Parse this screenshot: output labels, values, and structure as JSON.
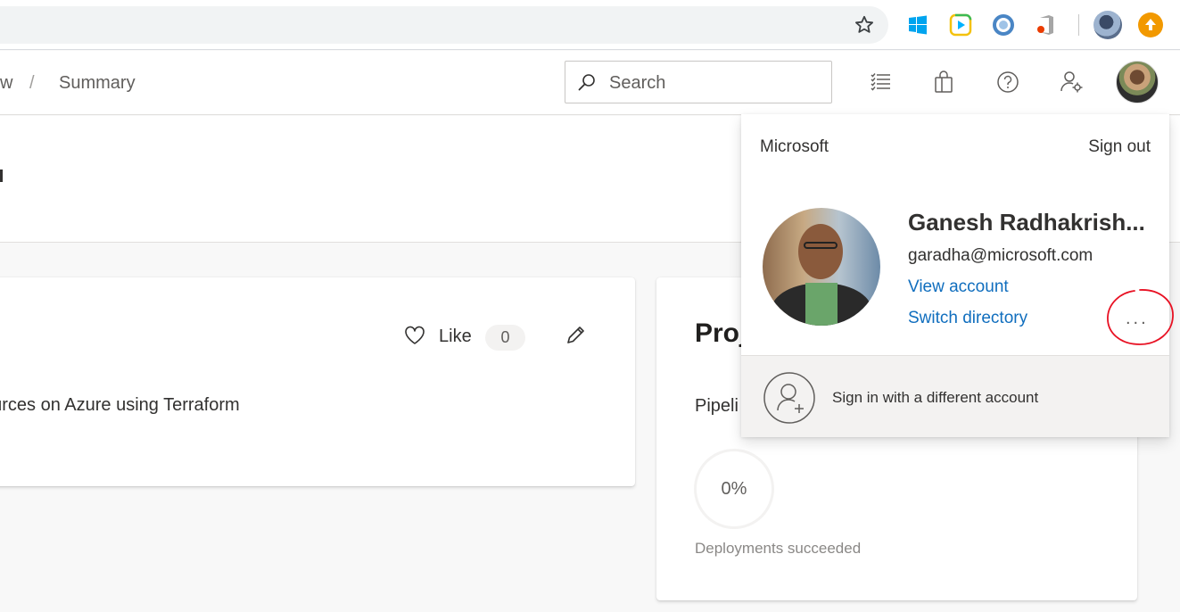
{
  "breadcrumb": {
    "partial": "w",
    "separator": "/",
    "current": "Summary"
  },
  "search": {
    "placeholder": "Search"
  },
  "about_card": {
    "like_label": "Like",
    "like_count": "0",
    "description": "ources on Azure using Terraform"
  },
  "stats_card": {
    "title": "Proj",
    "subtitle": "Pipeli",
    "percent": "0%",
    "caption": "Deployments succeeded"
  },
  "account_panel": {
    "organization": "Microsoft",
    "sign_out": "Sign out",
    "name": "Ganesh Radhakrish...",
    "email": "garadha@microsoft.com",
    "view_account": "View account",
    "switch_directory": "Switch directory",
    "more": "...",
    "sign_in_different": "Sign in with a different account"
  },
  "colors": {
    "accent_link": "#106ebe",
    "annotation": "#e81123",
    "update_badge": "#f29900"
  },
  "icons": [
    "star-icon",
    "windows-icon",
    "play-icon",
    "circle-logo-icon",
    "office-icon",
    "update-icon",
    "search-icon",
    "backlog-icon",
    "marketplace-bag-icon",
    "help-icon",
    "user-settings-icon",
    "heart-icon",
    "edit-icon",
    "add-account-icon"
  ]
}
